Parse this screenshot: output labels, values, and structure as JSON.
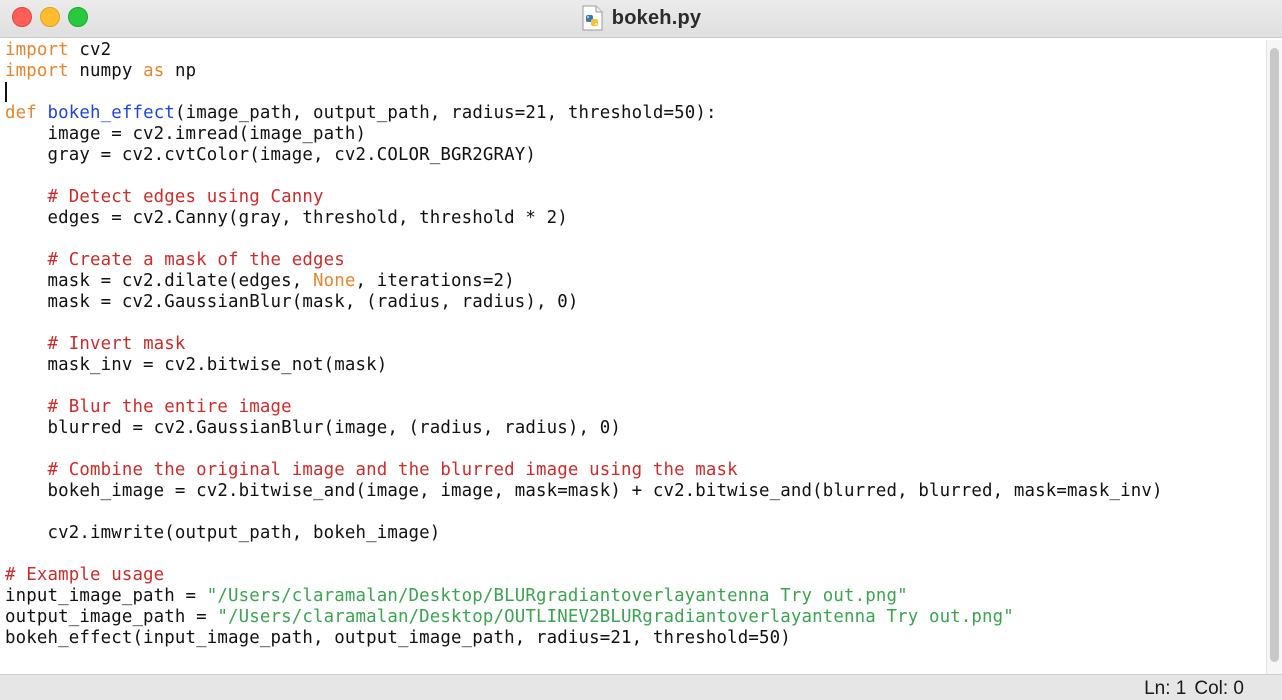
{
  "window": {
    "title": "bokeh.py",
    "file_icon": "python-file-icon"
  },
  "editor": {
    "language": "python",
    "lines": [
      [
        {
          "t": "import",
          "c": "kw"
        },
        {
          "t": " cv2"
        }
      ],
      [
        {
          "t": "import",
          "c": "kw"
        },
        {
          "t": " numpy "
        },
        {
          "t": "as",
          "c": "kw"
        },
        {
          "t": " np"
        }
      ],
      [],
      [
        {
          "t": "def",
          "c": "kw"
        },
        {
          "t": " "
        },
        {
          "t": "bokeh_effect",
          "c": "fn"
        },
        {
          "t": "(image_path, output_path, radius=21, threshold=50):"
        }
      ],
      [
        {
          "t": "    image = cv2.imread(image_path)"
        }
      ],
      [
        {
          "t": "    gray = cv2.cvtColor(image, cv2.COLOR_BGR2GRAY)"
        }
      ],
      [],
      [
        {
          "t": "    "
        },
        {
          "t": "# Detect edges using Canny",
          "c": "cm"
        }
      ],
      [
        {
          "t": "    edges = cv2.Canny(gray, threshold, threshold * 2)"
        }
      ],
      [],
      [
        {
          "t": "    "
        },
        {
          "t": "# Create a mask of the edges",
          "c": "cm"
        }
      ],
      [
        {
          "t": "    mask = cv2.dilate(edges, "
        },
        {
          "t": "None",
          "c": "kw"
        },
        {
          "t": ", iterations=2)"
        }
      ],
      [
        {
          "t": "    mask = cv2.GaussianBlur(mask, (radius, radius), 0)"
        }
      ],
      [],
      [
        {
          "t": "    "
        },
        {
          "t": "# Invert mask",
          "c": "cm"
        }
      ],
      [
        {
          "t": "    mask_inv = cv2.bitwise_not(mask)"
        }
      ],
      [],
      [
        {
          "t": "    "
        },
        {
          "t": "# Blur the entire image",
          "c": "cm"
        }
      ],
      [
        {
          "t": "    blurred = cv2.GaussianBlur(image, (radius, radius), 0)"
        }
      ],
      [],
      [
        {
          "t": "    "
        },
        {
          "t": "# Combine the original image and the blurred image using the mask",
          "c": "cm"
        }
      ],
      [
        {
          "t": "    bokeh_image = cv2.bitwise_and(image, image, mask=mask) + cv2.bitwise_and(blurred, blurred, mask=mask_inv)"
        }
      ],
      [],
      [
        {
          "t": "    cv2.imwrite(output_path, bokeh_image)"
        }
      ],
      [],
      [
        {
          "t": "# Example usage",
          "c": "cm"
        }
      ],
      [
        {
          "t": "input_image_path = "
        },
        {
          "t": "\"/Users/claramalan/Desktop/BLURgradiantoverlayantenna Try out.png\"",
          "c": "st"
        }
      ],
      [
        {
          "t": "output_image_path = "
        },
        {
          "t": "\"/Users/claramalan/Desktop/OUTLINEV2BLURgradiantoverlayantenna Try out.png\"",
          "c": "st"
        }
      ],
      [
        {
          "t": "bokeh_effect(input_image_path, output_image_path, radius=21, threshold=50)"
        }
      ]
    ]
  },
  "status": {
    "line": "Ln: 1",
    "col": "Col: 0"
  },
  "colors": {
    "keyword": "#e8852c",
    "function": "#1f46d8",
    "comment": "#d02b2b",
    "string": "#3aa54f",
    "close_button": "#ff5f57",
    "minimize_button": "#febc2e",
    "zoom_button": "#28c840"
  }
}
